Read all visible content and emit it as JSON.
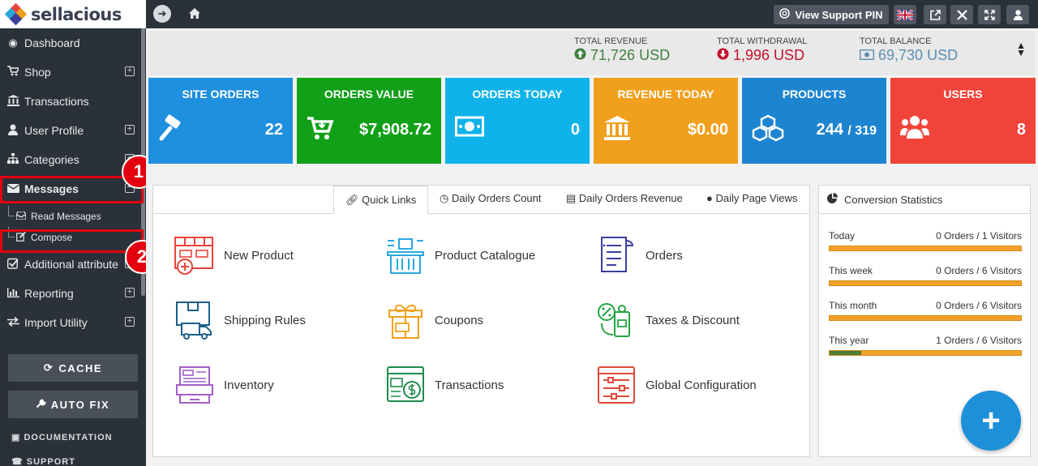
{
  "app": {
    "logo_text": "sellacious"
  },
  "sidebar": {
    "items": [
      {
        "label": "Dashboard",
        "icon": "dashboard-icon",
        "expandable": false
      },
      {
        "label": "Shop",
        "icon": "cart-icon",
        "expandable": true
      },
      {
        "label": "Transactions",
        "icon": "bank-icon",
        "expandable": false
      },
      {
        "label": "User Profile",
        "icon": "user-icon",
        "expandable": true
      },
      {
        "label": "Categories",
        "icon": "sitemap-icon",
        "expandable": true
      },
      {
        "label": "Messages",
        "icon": "envelope-icon",
        "expandable": true,
        "active": true
      },
      {
        "label": "Additional attribute",
        "icon": "check-square-icon",
        "expandable": true
      },
      {
        "label": "Reporting",
        "icon": "bar-chart-icon",
        "expandable": true
      },
      {
        "label": "Import Utility",
        "icon": "exchange-icon",
        "expandable": true
      }
    ],
    "sub_items": [
      {
        "label": "Read Messages",
        "icon": "inbox-icon"
      },
      {
        "label": "Compose",
        "icon": "edit-icon"
      }
    ],
    "buttons": {
      "cache": "CACHE",
      "auto_fix": "AUTO FIX"
    },
    "links": {
      "documentation": "DOCUMENTATION",
      "support": "SUPPORT"
    },
    "callouts": [
      "1",
      "2"
    ]
  },
  "topbar": {
    "view_support_pin": "View Support PIN"
  },
  "totals": {
    "revenue": {
      "label": "TOTAL REVENUE",
      "value": "71,726 USD",
      "color": "#3f7f3f"
    },
    "withdrawal": {
      "label": "TOTAL WITHDRAWAL",
      "value": "1,996 USD",
      "color": "#c0102b"
    },
    "balance": {
      "label": "TOTAL BALANCE",
      "value": "69,730 USD",
      "color": "#5a8fb0"
    }
  },
  "tiles": [
    {
      "title": "SITE ORDERS",
      "value": "22",
      "color": "#1f8fe0",
      "icon": "gavel-icon"
    },
    {
      "title": "ORDERS VALUE",
      "value": "$7,908.72",
      "color": "#11a018",
      "icon": "cart-download-icon"
    },
    {
      "title": "ORDERS TODAY",
      "value": "0",
      "color": "#0fb3ea",
      "icon": "money-icon"
    },
    {
      "title": "REVENUE TODAY",
      "value": "$0.00",
      "color": "#f0a01c",
      "icon": "bank-icon"
    },
    {
      "title": "PRODUCTS",
      "value": "244",
      "value_sub": "/ 319",
      "color": "#1d84d0",
      "icon": "cubes-icon"
    },
    {
      "title": "USERS",
      "value": "8",
      "color": "#f0443a",
      "icon": "users-icon"
    }
  ],
  "quick_links": {
    "tabs": [
      {
        "label": "Quick Links",
        "icon": "link-icon",
        "active": true
      },
      {
        "label": "Daily Orders Count",
        "icon": "clock-icon"
      },
      {
        "label": "Daily Orders Revenue",
        "icon": "money-icon"
      },
      {
        "label": "Daily Page Views",
        "icon": "globe-icon"
      }
    ],
    "items": [
      {
        "label": "New Product",
        "icon": "new-product-icon",
        "color": "#e8443a"
      },
      {
        "label": "Product Catalogue",
        "icon": "product-catalogue-icon",
        "color": "#2aa8dd"
      },
      {
        "label": "Orders",
        "icon": "orders-icon",
        "color": "#3b3f9c"
      },
      {
        "label": "Shipping Rules",
        "icon": "shipping-rules-icon",
        "color": "#1c5f8c"
      },
      {
        "label": "Coupons",
        "icon": "coupons-icon",
        "color": "#f0a01c"
      },
      {
        "label": "Taxes & Discount",
        "icon": "taxes-discount-icon",
        "color": "#23a542"
      },
      {
        "label": "Inventory",
        "icon": "inventory-icon",
        "color": "#a45fc8"
      },
      {
        "label": "Transactions",
        "icon": "transactions-icon",
        "color": "#1e8a4a"
      },
      {
        "label": "Global Configuration",
        "icon": "global-configuration-icon",
        "color": "#e24a3a"
      }
    ]
  },
  "conversion": {
    "title": "Conversion Statistics",
    "rows": [
      {
        "label": "Today",
        "value": "0 Orders / 1 Visitors",
        "rate": 0
      },
      {
        "label": "This week",
        "value": "0 Orders / 6 Visitors",
        "rate": 0
      },
      {
        "label": "This month",
        "value": "0 Orders / 6 Visitors",
        "rate": 0
      },
      {
        "label": "This year",
        "value": "1 Orders / 6 Visitors",
        "rate": 0.167
      }
    ]
  },
  "fab": {
    "label": "+"
  }
}
